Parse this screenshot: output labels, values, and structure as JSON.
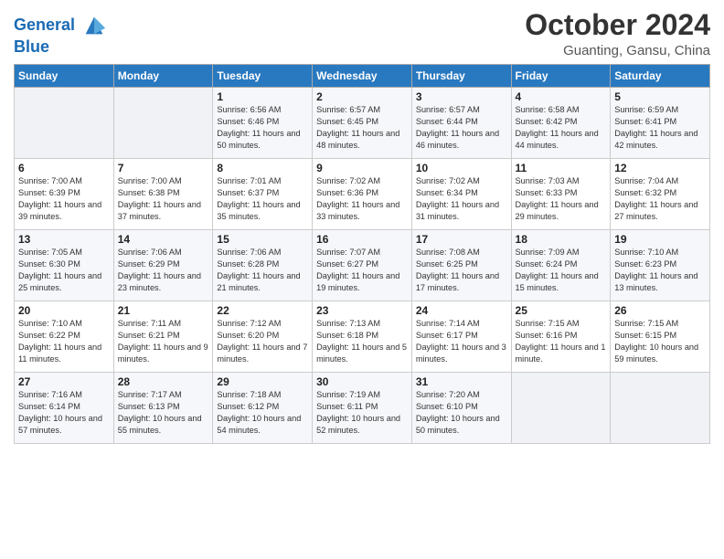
{
  "header": {
    "logo_line1": "General",
    "logo_line2": "Blue",
    "month": "October 2024",
    "location": "Guanting, Gansu, China"
  },
  "days_of_week": [
    "Sunday",
    "Monday",
    "Tuesday",
    "Wednesday",
    "Thursday",
    "Friday",
    "Saturday"
  ],
  "weeks": [
    [
      {
        "day": "",
        "info": ""
      },
      {
        "day": "",
        "info": ""
      },
      {
        "day": "1",
        "info": "Sunrise: 6:56 AM\nSunset: 6:46 PM\nDaylight: 11 hours and 50 minutes."
      },
      {
        "day": "2",
        "info": "Sunrise: 6:57 AM\nSunset: 6:45 PM\nDaylight: 11 hours and 48 minutes."
      },
      {
        "day": "3",
        "info": "Sunrise: 6:57 AM\nSunset: 6:44 PM\nDaylight: 11 hours and 46 minutes."
      },
      {
        "day": "4",
        "info": "Sunrise: 6:58 AM\nSunset: 6:42 PM\nDaylight: 11 hours and 44 minutes."
      },
      {
        "day": "5",
        "info": "Sunrise: 6:59 AM\nSunset: 6:41 PM\nDaylight: 11 hours and 42 minutes."
      }
    ],
    [
      {
        "day": "6",
        "info": "Sunrise: 7:00 AM\nSunset: 6:39 PM\nDaylight: 11 hours and 39 minutes."
      },
      {
        "day": "7",
        "info": "Sunrise: 7:00 AM\nSunset: 6:38 PM\nDaylight: 11 hours and 37 minutes."
      },
      {
        "day": "8",
        "info": "Sunrise: 7:01 AM\nSunset: 6:37 PM\nDaylight: 11 hours and 35 minutes."
      },
      {
        "day": "9",
        "info": "Sunrise: 7:02 AM\nSunset: 6:36 PM\nDaylight: 11 hours and 33 minutes."
      },
      {
        "day": "10",
        "info": "Sunrise: 7:02 AM\nSunset: 6:34 PM\nDaylight: 11 hours and 31 minutes."
      },
      {
        "day": "11",
        "info": "Sunrise: 7:03 AM\nSunset: 6:33 PM\nDaylight: 11 hours and 29 minutes."
      },
      {
        "day": "12",
        "info": "Sunrise: 7:04 AM\nSunset: 6:32 PM\nDaylight: 11 hours and 27 minutes."
      }
    ],
    [
      {
        "day": "13",
        "info": "Sunrise: 7:05 AM\nSunset: 6:30 PM\nDaylight: 11 hours and 25 minutes."
      },
      {
        "day": "14",
        "info": "Sunrise: 7:06 AM\nSunset: 6:29 PM\nDaylight: 11 hours and 23 minutes."
      },
      {
        "day": "15",
        "info": "Sunrise: 7:06 AM\nSunset: 6:28 PM\nDaylight: 11 hours and 21 minutes."
      },
      {
        "day": "16",
        "info": "Sunrise: 7:07 AM\nSunset: 6:27 PM\nDaylight: 11 hours and 19 minutes."
      },
      {
        "day": "17",
        "info": "Sunrise: 7:08 AM\nSunset: 6:25 PM\nDaylight: 11 hours and 17 minutes."
      },
      {
        "day": "18",
        "info": "Sunrise: 7:09 AM\nSunset: 6:24 PM\nDaylight: 11 hours and 15 minutes."
      },
      {
        "day": "19",
        "info": "Sunrise: 7:10 AM\nSunset: 6:23 PM\nDaylight: 11 hours and 13 minutes."
      }
    ],
    [
      {
        "day": "20",
        "info": "Sunrise: 7:10 AM\nSunset: 6:22 PM\nDaylight: 11 hours and 11 minutes."
      },
      {
        "day": "21",
        "info": "Sunrise: 7:11 AM\nSunset: 6:21 PM\nDaylight: 11 hours and 9 minutes."
      },
      {
        "day": "22",
        "info": "Sunrise: 7:12 AM\nSunset: 6:20 PM\nDaylight: 11 hours and 7 minutes."
      },
      {
        "day": "23",
        "info": "Sunrise: 7:13 AM\nSunset: 6:18 PM\nDaylight: 11 hours and 5 minutes."
      },
      {
        "day": "24",
        "info": "Sunrise: 7:14 AM\nSunset: 6:17 PM\nDaylight: 11 hours and 3 minutes."
      },
      {
        "day": "25",
        "info": "Sunrise: 7:15 AM\nSunset: 6:16 PM\nDaylight: 11 hours and 1 minute."
      },
      {
        "day": "26",
        "info": "Sunrise: 7:15 AM\nSunset: 6:15 PM\nDaylight: 10 hours and 59 minutes."
      }
    ],
    [
      {
        "day": "27",
        "info": "Sunrise: 7:16 AM\nSunset: 6:14 PM\nDaylight: 10 hours and 57 minutes."
      },
      {
        "day": "28",
        "info": "Sunrise: 7:17 AM\nSunset: 6:13 PM\nDaylight: 10 hours and 55 minutes."
      },
      {
        "day": "29",
        "info": "Sunrise: 7:18 AM\nSunset: 6:12 PM\nDaylight: 10 hours and 54 minutes."
      },
      {
        "day": "30",
        "info": "Sunrise: 7:19 AM\nSunset: 6:11 PM\nDaylight: 10 hours and 52 minutes."
      },
      {
        "day": "31",
        "info": "Sunrise: 7:20 AM\nSunset: 6:10 PM\nDaylight: 10 hours and 50 minutes."
      },
      {
        "day": "",
        "info": ""
      },
      {
        "day": "",
        "info": ""
      }
    ]
  ]
}
